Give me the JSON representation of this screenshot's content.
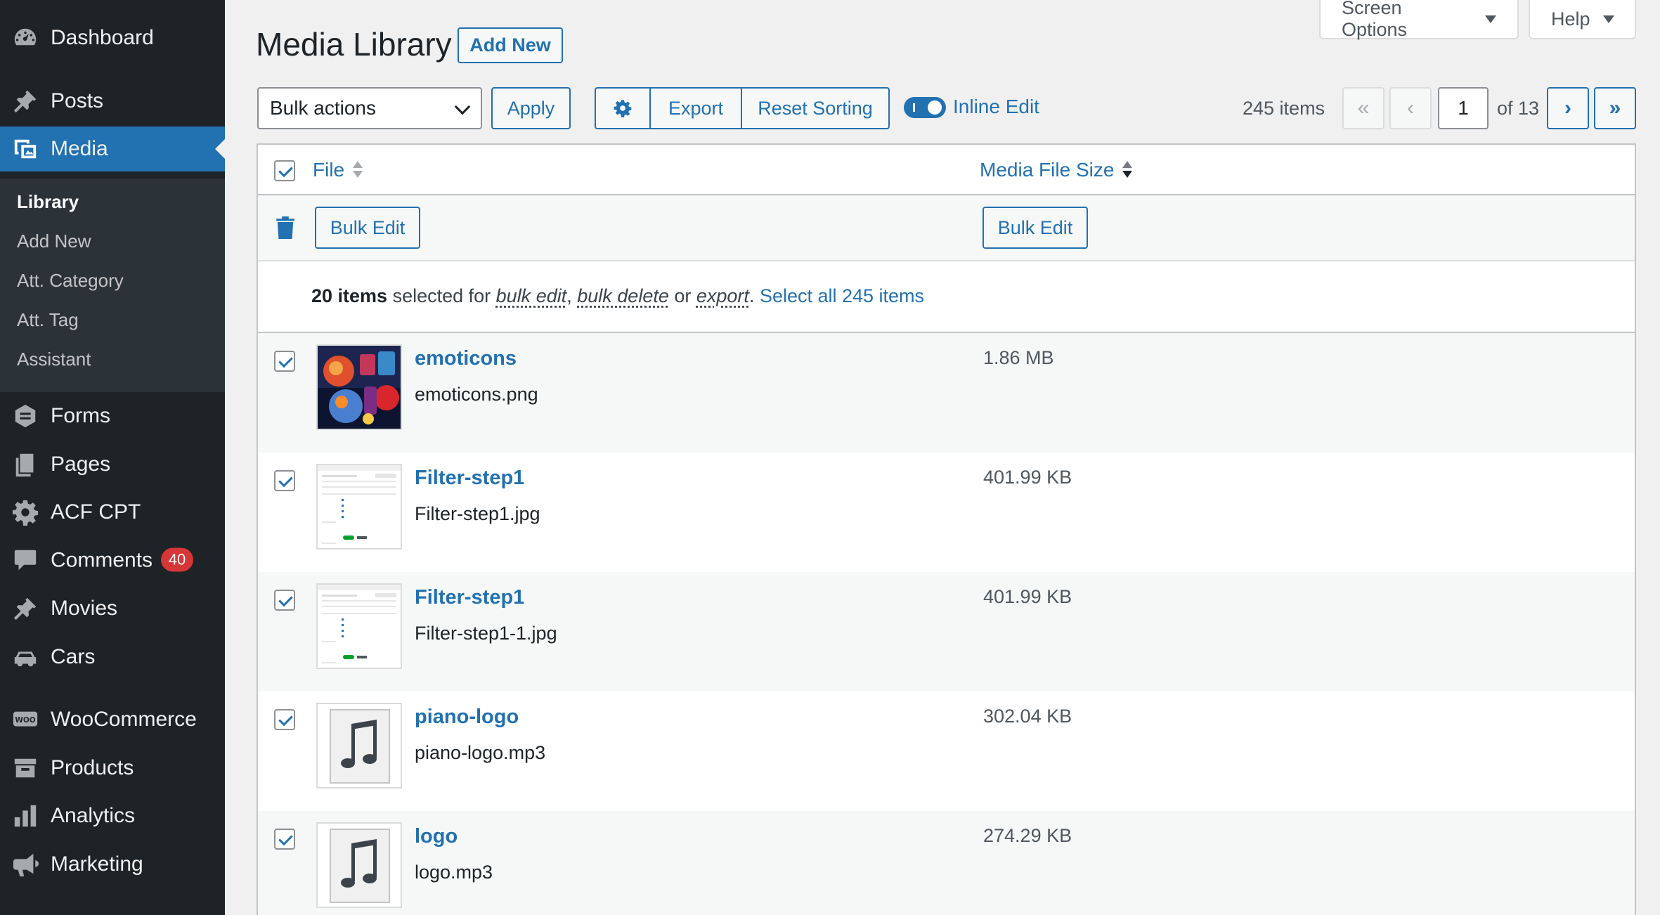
{
  "sidebar": {
    "items": [
      {
        "label": "Dashboard",
        "icon": "dashboard-icon"
      },
      {
        "label": "Posts",
        "icon": "pin-icon"
      },
      {
        "label": "Media",
        "icon": "media-icon"
      },
      {
        "label": "Forms",
        "icon": "forms-icon"
      },
      {
        "label": "Pages",
        "icon": "pages-icon"
      },
      {
        "label": "ACF CPT",
        "icon": "gear-icon"
      },
      {
        "label": "Comments",
        "icon": "comment-icon",
        "badge": "40"
      },
      {
        "label": "Movies",
        "icon": "pin-icon"
      },
      {
        "label": "Cars",
        "icon": "car-icon"
      },
      {
        "label": "WooCommerce",
        "icon": "woo-icon"
      },
      {
        "label": "Products",
        "icon": "archive-icon"
      },
      {
        "label": "Analytics",
        "icon": "bar-chart-icon"
      },
      {
        "label": "Marketing",
        "icon": "megaphone-icon"
      }
    ],
    "submenu": [
      "Library",
      "Add New",
      "Att. Category",
      "Att. Tag",
      "Assistant"
    ],
    "active_item": "Media",
    "current_subitem": "Library"
  },
  "screen_meta": {
    "screen_options": "Screen Options",
    "help": "Help"
  },
  "header": {
    "title": "Media Library",
    "add_new": "Add New"
  },
  "toolbar": {
    "bulk_actions": "Bulk actions",
    "apply": "Apply",
    "settings_icon": "gear-icon",
    "export": "Export",
    "reset_sorting": "Reset Sorting",
    "inline_edit": "Inline Edit",
    "inline_edit_on": true
  },
  "pagination": {
    "items": "245 items",
    "first": "«",
    "prev": "‹",
    "current_page": "1",
    "of": "of 13",
    "next": "›",
    "last": "»"
  },
  "table": {
    "columns": {
      "file": "File",
      "size": "Media File Size"
    },
    "sorted_by": "Media File Size",
    "sort_direction": "desc",
    "bulk_edit": "Bulk Edit",
    "notice": {
      "count": "20 items",
      "text1": " selected for ",
      "bulk_edit": "bulk edit",
      "comma": ", ",
      "bulk_delete": "bulk delete",
      "or": " or ",
      "export": "export",
      "period": ". ",
      "select_all": "Select all 245 items"
    },
    "rows": [
      {
        "title": "emoticons",
        "file": "emoticons.png",
        "size": "1.86 MB",
        "thumb": "image",
        "checked": true
      },
      {
        "title": "Filter-step1",
        "file": "Filter-step1.jpg",
        "size": "401.99 KB",
        "thumb": "screenshot",
        "checked": true
      },
      {
        "title": "Filter-step1",
        "file": "Filter-step1-1.jpg",
        "size": "401.99 KB",
        "thumb": "screenshot",
        "checked": true
      },
      {
        "title": "piano-logo",
        "file": "piano-logo.mp3",
        "size": "302.04 KB",
        "thumb": "audio",
        "checked": true
      },
      {
        "title": "logo",
        "file": "logo.mp3",
        "size": "274.29 KB",
        "thumb": "audio",
        "checked": true
      }
    ]
  },
  "colors": {
    "accent": "#2271b1",
    "sidebar_bg": "#1d2327",
    "submenu_bg": "#2c3338",
    "badge": "#d63638"
  }
}
